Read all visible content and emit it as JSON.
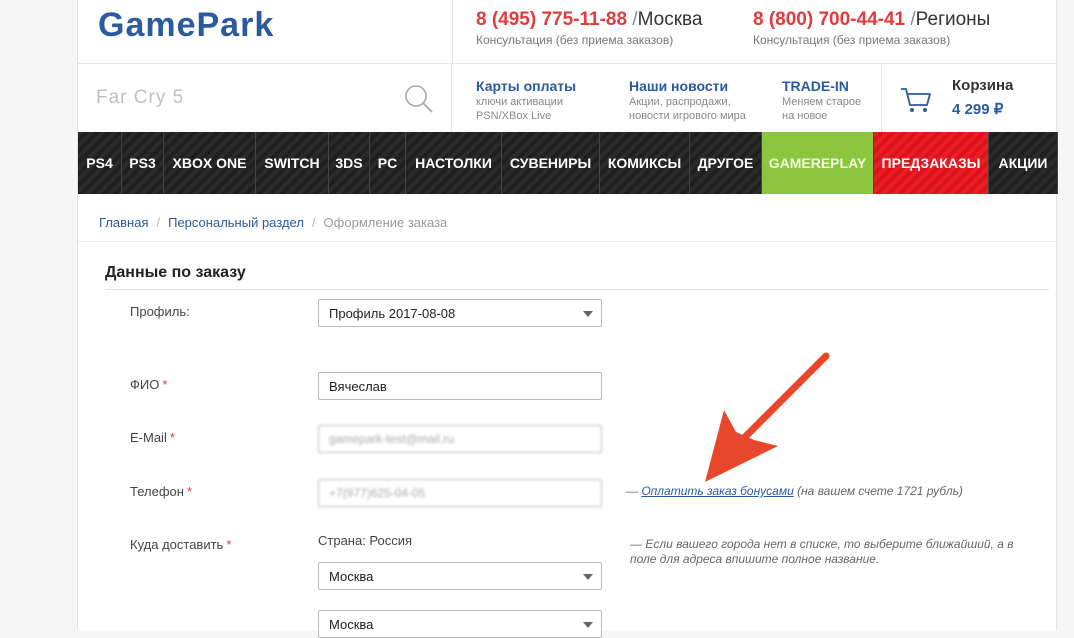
{
  "header": {
    "logo": "GamePark",
    "phones": [
      {
        "number": "8 (495) 775-11-88",
        "sep": " /",
        "city": "Москва",
        "sub": "Консультация (без приема заказов)"
      },
      {
        "number": "8 (800) 700-44-41",
        "sep": " /",
        "city": "Регионы",
        "sub": "Консультация (без приема заказов)"
      }
    ],
    "search": {
      "placeholder": "Far Cry 5",
      "icon": "search-icon"
    },
    "info_links": [
      {
        "title": "Карты оплаты",
        "sub1": "ключи активации",
        "sub2": "PSN/XBox Live"
      },
      {
        "title": "Наши новости",
        "sub1": "Акции, распродажи,",
        "sub2": "новости игрового мира"
      },
      {
        "title": "TRADE-IN",
        "sub1": "Меняем старое",
        "sub2": "на новое"
      }
    ],
    "cart": {
      "title": "Корзина",
      "sum": "4 299 ₽",
      "icon": "cart-icon"
    }
  },
  "nav": [
    {
      "label": "PS4",
      "style": "normal"
    },
    {
      "label": "PS3",
      "style": "normal"
    },
    {
      "label": "XBOX ONE",
      "style": "normal"
    },
    {
      "label": "SWITCH",
      "style": "normal"
    },
    {
      "label": "3DS",
      "style": "normal"
    },
    {
      "label": "PC",
      "style": "normal"
    },
    {
      "label": "НАСТОЛКИ",
      "style": "normal"
    },
    {
      "label": "СУВЕНИРЫ",
      "style": "normal"
    },
    {
      "label": "КОМИКСЫ",
      "style": "normal"
    },
    {
      "label": "ДРУГОЕ",
      "style": "normal"
    },
    {
      "label": "GAMEREPLAY",
      "style": "green"
    },
    {
      "label": "ПРЕДЗАКАЗЫ",
      "style": "red"
    },
    {
      "label": "АКЦИИ",
      "style": "normal"
    }
  ],
  "breadcrumb": {
    "home": "Главная",
    "personal": "Персональный раздел",
    "current": "Оформление заказа",
    "sep": "/"
  },
  "form": {
    "title": "Данные по заказу",
    "profile_label": "Профиль:",
    "profile_value": "Профиль 2017-08-08",
    "name_label": "ФИО",
    "name_value": "Вячеслав",
    "email_label": "E-Mail",
    "email_value": "gamepark-test@mail.ru",
    "phone_label": "Телефон",
    "phone_value": "+7(977)625-04-05",
    "delivery_label": "Куда доставить",
    "country": "Страна: Россия",
    "region_value": "Москва",
    "city_value": "Москва",
    "required_mark": "*"
  },
  "bonus": {
    "dash": "— ",
    "link": "Оплатить заказ бонусами",
    "note": " (на вашем счете 1721 рубль)"
  },
  "hint": "— Если вашего города нет в списке, то выберите ближайший, а в поле для адреса впишите полное название.",
  "colors": {
    "brand": "#2b5a9e",
    "accent_red": "#e23b3b",
    "nav_green": "#8cc63f",
    "nav_red": "#ee1c24",
    "arrow": "#e8472c"
  }
}
